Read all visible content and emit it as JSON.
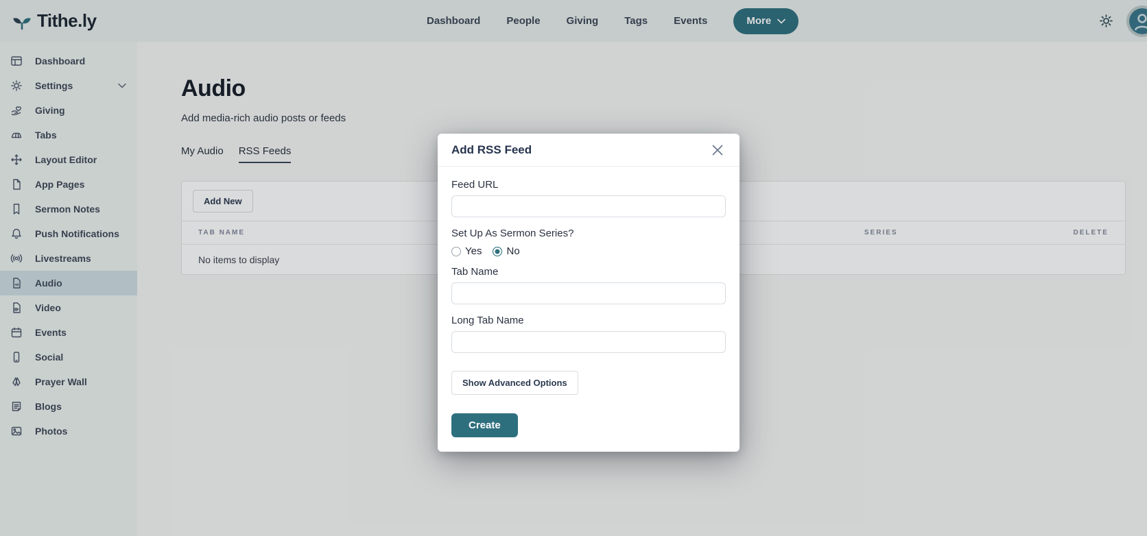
{
  "colors": {
    "accent_teal": "#2e6f7e",
    "topbar_bg": "#e7eeeb",
    "sidebar_bg": "#ecf2ef",
    "sidebar_active_bg": "#cfdde3",
    "modal_bg": "#ffffff",
    "title_text": "#161d27"
  },
  "topbar": {
    "logo_text": "Tithe.ly",
    "nav_items": [
      "Dashboard",
      "People",
      "Giving",
      "Tags",
      "Events"
    ],
    "more_label": "More"
  },
  "sidebar": {
    "items": [
      {
        "label": "Dashboard",
        "icon": "dashboard-icon"
      },
      {
        "label": "Settings",
        "icon": "settings-gear-icon",
        "has_chevron": true
      },
      {
        "label": "Giving",
        "icon": "giving-hand-heart-icon"
      },
      {
        "label": "Tabs",
        "icon": "tabs-icon"
      },
      {
        "label": "Layout Editor",
        "icon": "move-arrows-icon"
      },
      {
        "label": "App Pages",
        "icon": "page-file-icon"
      },
      {
        "label": "Sermon Notes",
        "icon": "bookmark-icon"
      },
      {
        "label": "Push Notifications",
        "icon": "bell-icon"
      },
      {
        "label": "Livestreams",
        "icon": "broadcast-icon"
      },
      {
        "label": "Audio",
        "icon": "audio-file-icon",
        "active": true
      },
      {
        "label": "Video",
        "icon": "video-file-icon"
      },
      {
        "label": "Events",
        "icon": "calendar-icon"
      },
      {
        "label": "Social",
        "icon": "phone-icon"
      },
      {
        "label": "Prayer Wall",
        "icon": "praying-hands-icon"
      },
      {
        "label": "Blogs",
        "icon": "blog-document-icon"
      },
      {
        "label": "Photos",
        "icon": "photo-image-icon"
      }
    ]
  },
  "page": {
    "title": "Audio",
    "subtitle": "Add media-rich audio posts or feeds",
    "tabs": [
      {
        "label": "My Audio",
        "active": false
      },
      {
        "label": "RSS Feeds",
        "active": true
      }
    ]
  },
  "table": {
    "add_new_label": "Add New",
    "columns": [
      "Tab Name",
      "Series",
      "Delete"
    ],
    "empty_message": "No items to display"
  },
  "modal": {
    "title": "Add RSS Feed",
    "feed_url_label": "Feed URL",
    "feed_url_value": "",
    "sermon_series_label": "Set Up As Sermon Series?",
    "radio_options": [
      {
        "label": "Yes",
        "selected": false
      },
      {
        "label": "No",
        "selected": true
      }
    ],
    "tab_name_label": "Tab Name",
    "tab_name_value": "",
    "long_tab_name_label": "Long Tab Name",
    "long_tab_name_value": "",
    "advanced_button_label": "Show Advanced Options",
    "create_button_label": "Create"
  }
}
